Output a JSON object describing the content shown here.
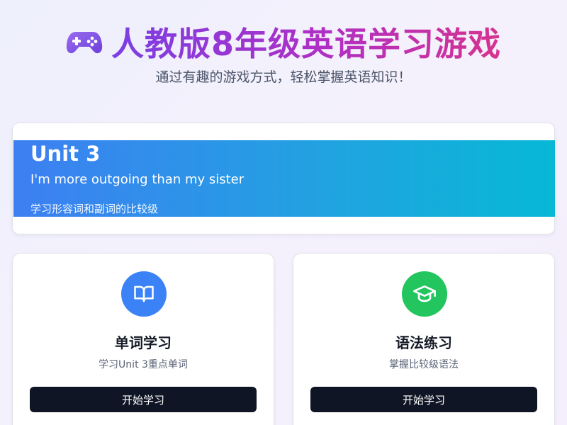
{
  "header": {
    "title": "人教版8年级英语学习游戏",
    "subtitle": "通过有趣的游戏方式，轻松掌握英语知识！",
    "icon": "gamepad-icon"
  },
  "unit": {
    "title": "Unit 3",
    "subtitle": "I'm more outgoing than my sister",
    "description": "学习形容词和副词的比较级"
  },
  "features": [
    {
      "title": "单词学习",
      "description": "学习Unit 3重点单词",
      "button_label": "开始学习",
      "icon": "book-icon",
      "icon_color": "#3b82f6"
    },
    {
      "title": "语法练习",
      "description": "掌握比较级语法",
      "button_label": "开始学习",
      "icon": "graduation-cap-icon",
      "icon_color": "#22c55e"
    }
  ],
  "colors": {
    "title_gradient_start": "#7b3fe4",
    "title_gradient_end": "#d6338f",
    "banner_gradient_start": "#3d7ff2",
    "banner_gradient_end": "#07b8d6",
    "button_bg": "#0f1524"
  }
}
